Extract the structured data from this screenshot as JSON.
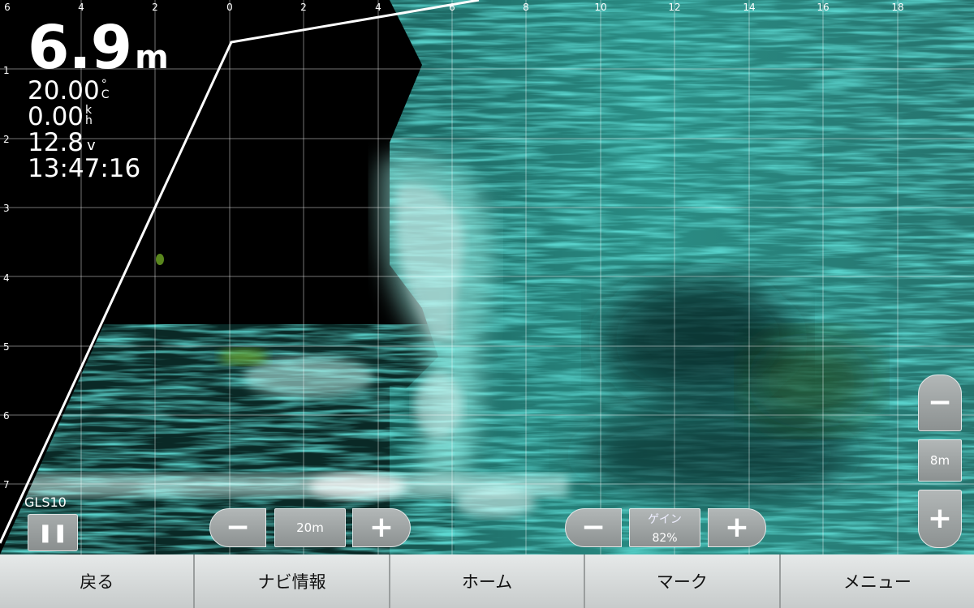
{
  "readout": {
    "depth_value": "6.9",
    "depth_unit": "m",
    "water_temp_value": "20.00",
    "water_temp_unit_top": "°",
    "water_temp_unit_bottom": "C",
    "speed_value": "0.00",
    "speed_unit_top": "k",
    "speed_unit_bottom": "h",
    "voltage_value": "12.8",
    "voltage_unit": "v",
    "clock": "13:47:16"
  },
  "top_scale_labels": [
    "6",
    "4",
    "2",
    "0",
    "2",
    "4",
    "6",
    "8",
    "10",
    "12",
    "14",
    "16",
    "18"
  ],
  "depth_scale_labels": [
    "1",
    "2",
    "3",
    "4",
    "5",
    "6",
    "7"
  ],
  "transducer": {
    "name": "GLS10",
    "pause_icon": "pause-icon"
  },
  "range_control": {
    "minus_label": "−",
    "value": "20m",
    "plus_label": "+"
  },
  "gain_control": {
    "minus_label": "−",
    "label": "ゲイン",
    "value": "82%",
    "plus_label": "+"
  },
  "zoom_control": {
    "minus_label": "−",
    "value": "8m",
    "plus_label": "+"
  },
  "nav": {
    "back": "戻る",
    "navi_info": "ナビ情報",
    "home": "ホーム",
    "mark": "マーク",
    "menu": "メニュー"
  },
  "colors": {
    "sonar_return": "#3fd6c6",
    "sonar_strong": "#e8fffc",
    "accent_green": "#7fbf2a"
  }
}
